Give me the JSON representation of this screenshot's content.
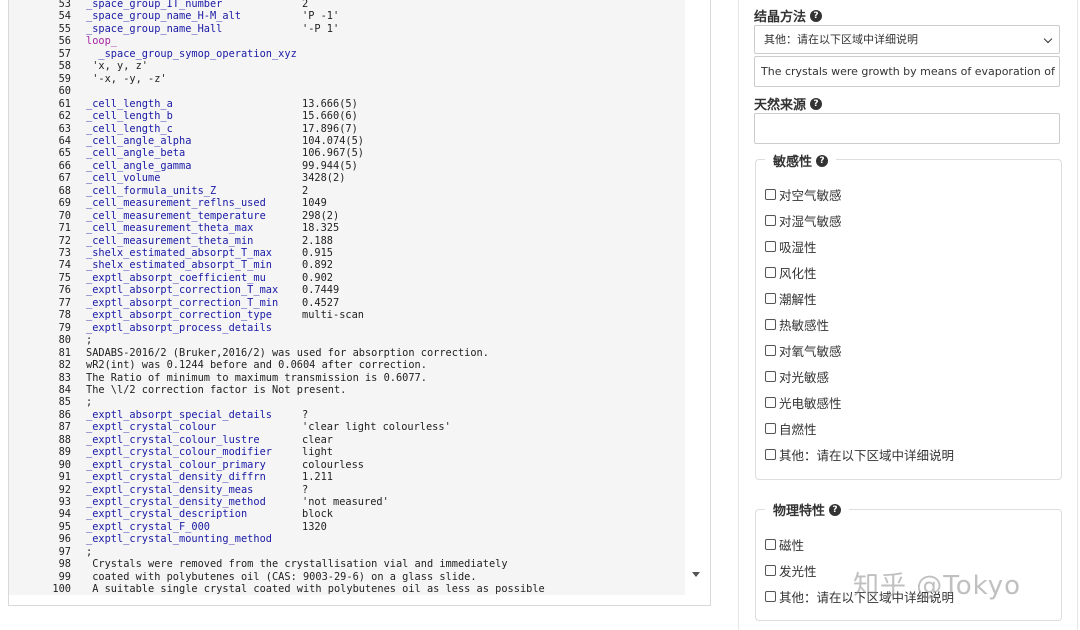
{
  "code": {
    "lines": [
      {
        "n": "53",
        "k": "_space_group_IT_number",
        "v": "2",
        "kc": "blue"
      },
      {
        "n": "54",
        "k": "_space_group_name_H-M_alt",
        "v": "'P -1'",
        "kc": "blue"
      },
      {
        "n": "55",
        "k": "_space_group_name_Hall",
        "v": "'-P 1'",
        "kc": "blue"
      },
      {
        "n": "56",
        "k": "loop_",
        "v": "",
        "kc": "purple"
      },
      {
        "n": "57",
        "k": "  _space_group_symop_operation_xyz",
        "v": "",
        "kc": "blue"
      },
      {
        "n": "58",
        "k": " 'x, y, z'",
        "v": "",
        "kc": "dark"
      },
      {
        "n": "59",
        "k": " '-x, -y, -z'",
        "v": "",
        "kc": "dark"
      },
      {
        "n": "60",
        "k": "",
        "v": "",
        "kc": "dark"
      },
      {
        "n": "61",
        "k": "_cell_length_a",
        "v": "13.666(5)",
        "kc": "blue"
      },
      {
        "n": "62",
        "k": "_cell_length_b",
        "v": "15.660(6)",
        "kc": "blue"
      },
      {
        "n": "63",
        "k": "_cell_length_c",
        "v": "17.896(7)",
        "kc": "blue"
      },
      {
        "n": "64",
        "k": "_cell_angle_alpha",
        "v": "104.074(5)",
        "kc": "blue"
      },
      {
        "n": "65",
        "k": "_cell_angle_beta",
        "v": "106.967(5)",
        "kc": "blue"
      },
      {
        "n": "66",
        "k": "_cell_angle_gamma",
        "v": "99.944(5)",
        "kc": "blue"
      },
      {
        "n": "67",
        "k": "_cell_volume",
        "v": "3428(2)",
        "kc": "blue"
      },
      {
        "n": "68",
        "k": "_cell_formula_units_Z",
        "v": "2",
        "kc": "blue"
      },
      {
        "n": "69",
        "k": "_cell_measurement_reflns_used",
        "v": "1049",
        "kc": "blue"
      },
      {
        "n": "70",
        "k": "_cell_measurement_temperature",
        "v": "298(2)",
        "kc": "blue"
      },
      {
        "n": "71",
        "k": "_cell_measurement_theta_max",
        "v": "18.325",
        "kc": "blue"
      },
      {
        "n": "72",
        "k": "_cell_measurement_theta_min",
        "v": "2.188",
        "kc": "blue"
      },
      {
        "n": "73",
        "k": "_shelx_estimated_absorpt_T_max",
        "v": "0.915",
        "kc": "blue"
      },
      {
        "n": "74",
        "k": "_shelx_estimated_absorpt_T_min",
        "v": "0.892",
        "kc": "blue"
      },
      {
        "n": "75",
        "k": "_exptl_absorpt_coefficient_mu",
        "v": "0.902",
        "kc": "blue"
      },
      {
        "n": "76",
        "k": "_exptl_absorpt_correction_T_max",
        "v": "0.7449",
        "kc": "blue"
      },
      {
        "n": "77",
        "k": "_exptl_absorpt_correction_T_min",
        "v": "0.4527",
        "kc": "blue"
      },
      {
        "n": "78",
        "k": "_exptl_absorpt_correction_type",
        "v": "multi-scan",
        "kc": "blue"
      },
      {
        "n": "79",
        "k": "_exptl_absorpt_process_details",
        "v": "",
        "kc": "blue"
      },
      {
        "n": "80",
        "k": ";",
        "v": "",
        "kc": "dark"
      },
      {
        "n": "81",
        "k": "SADABS-2016/2 (Bruker,2016/2) was used for absorption correction.",
        "v": "",
        "kc": "dark"
      },
      {
        "n": "82",
        "k": "wR2(int) was 0.1244 before and 0.0604 after correction.",
        "v": "",
        "kc": "dark"
      },
      {
        "n": "83",
        "k": "The Ratio of minimum to maximum transmission is 0.6077.",
        "v": "",
        "kc": "dark"
      },
      {
        "n": "84",
        "k": "The \\l/2 correction factor is Not present.",
        "v": "",
        "kc": "dark"
      },
      {
        "n": "85",
        "k": ";",
        "v": "",
        "kc": "dark"
      },
      {
        "n": "86",
        "k": "_exptl_absorpt_special_details",
        "v": "?",
        "kc": "blue"
      },
      {
        "n": "87",
        "k": "_exptl_crystal_colour",
        "v": "'clear light colourless'",
        "kc": "blue"
      },
      {
        "n": "88",
        "k": "_exptl_crystal_colour_lustre",
        "v": "clear",
        "kc": "blue"
      },
      {
        "n": "89",
        "k": "_exptl_crystal_colour_modifier",
        "v": "light",
        "kc": "blue"
      },
      {
        "n": "90",
        "k": "_exptl_crystal_colour_primary",
        "v": "colourless",
        "kc": "blue"
      },
      {
        "n": "91",
        "k": "_exptl_crystal_density_diffrn",
        "v": "1.211",
        "kc": "blue"
      },
      {
        "n": "92",
        "k": "_exptl_crystal_density_meas",
        "v": "?",
        "kc": "blue"
      },
      {
        "n": "93",
        "k": "_exptl_crystal_density_method",
        "v": "'not measured'",
        "kc": "blue"
      },
      {
        "n": "94",
        "k": "_exptl_crystal_description",
        "v": "block",
        "kc": "blue"
      },
      {
        "n": "95",
        "k": "_exptl_crystal_F_000",
        "v": "1320",
        "kc": "blue"
      },
      {
        "n": "96",
        "k": "_exptl_crystal_mounting_method",
        "v": "",
        "kc": "blue"
      },
      {
        "n": "97",
        "k": ";",
        "v": "",
        "kc": "dark"
      },
      {
        "n": "98",
        "k": " Crystals were removed from the crystallisation vial and immediately",
        "v": "",
        "kc": "dark"
      },
      {
        "n": "99",
        "k": " coated with polybutenes oil (CAS: 9003-29-6) on a glass slide.",
        "v": "",
        "kc": "dark"
      },
      {
        "n": "100",
        "k": " A suitable single crystal coated with polybutenes oil as less as possible",
        "v": "",
        "kc": "dark"
      }
    ]
  },
  "form": {
    "crystallization": {
      "label": "结晶方法",
      "selected": "其他：请在以下区域中详细说明",
      "detail_value": "The crystals were growth by means of evaporation of a mix"
    },
    "natural_source": {
      "label": "天然来源",
      "value": ""
    },
    "sensitivity": {
      "legend": "敏感性",
      "options": [
        "对空气敏感",
        "对湿气敏感",
        "吸湿性",
        "风化性",
        "潮解性",
        "热敏感性",
        "对氧气敏感",
        "对光敏感",
        "光电敏感性",
        "自燃性",
        "其他：请在以下区域中详细说明"
      ]
    },
    "physical": {
      "legend": "物理特性",
      "options": [
        "磁性",
        "发光性",
        "其他：请在以下区域中详细说明"
      ]
    }
  },
  "watermark": "知乎 @Tokyo"
}
